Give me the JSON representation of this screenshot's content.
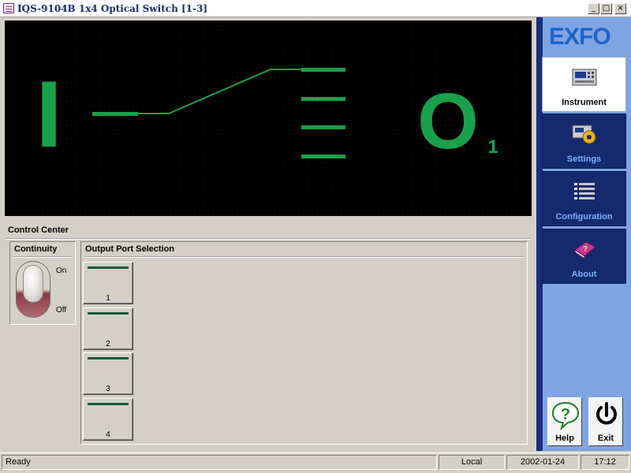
{
  "window": {
    "title": "IQS-9104B 1x4 Optical Switch [1-3]",
    "min_glyph": "_",
    "max_glyph": "□",
    "close_glyph": "×"
  },
  "display": {
    "input_label": "I",
    "output_label": "O",
    "output_sub": "1",
    "color": "#1aa04a",
    "active_port": 1,
    "port_count": 4
  },
  "control_center": {
    "title": "Control Center",
    "continuity": {
      "title": "Continuity",
      "on_label": "On",
      "off_label": "Off",
      "state": "On"
    },
    "output_selection": {
      "title": "Output Port Selection",
      "ports": [
        "1",
        "2",
        "3",
        "4"
      ]
    }
  },
  "brand": {
    "logo": "EXFO",
    "logo_color": "#1d64c8"
  },
  "nav": {
    "instrument": "Instrument",
    "settings": "Settings",
    "configuration": "Configuration",
    "about": "About",
    "active": "instrument"
  },
  "actions": {
    "help": "Help",
    "exit": "Exit"
  },
  "status": {
    "ready": "Ready",
    "mode": "Local",
    "date": "2002-01-24",
    "time": "17:12"
  }
}
